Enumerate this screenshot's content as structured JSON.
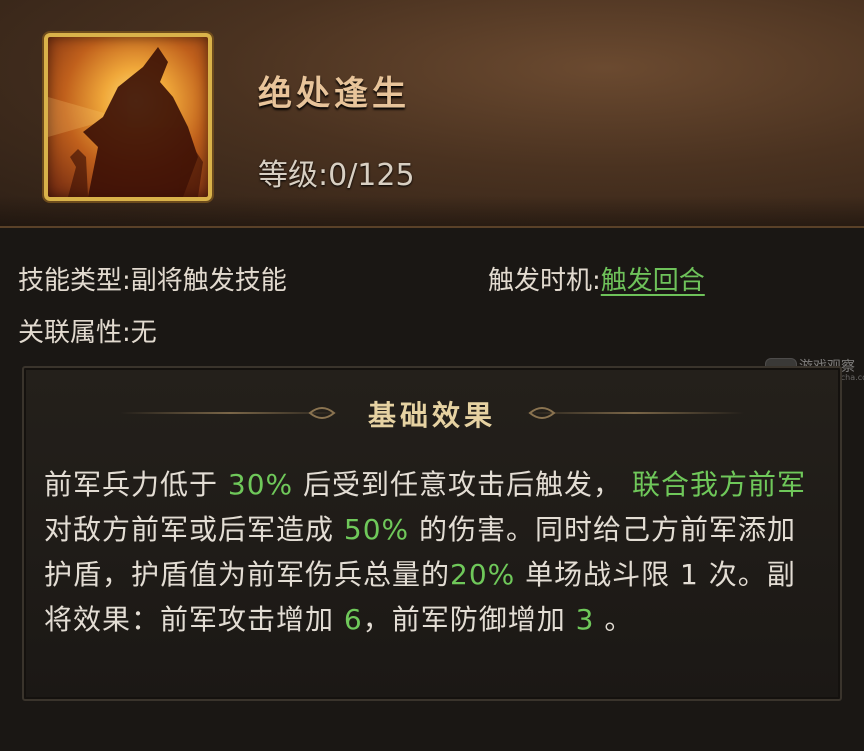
{
  "skill": {
    "name": "绝处逢生",
    "level_label": "等级:",
    "level_value": "0/125"
  },
  "info": {
    "type_label": "技能类型:",
    "type_value": "副将触发技能",
    "trigger_label": "触发时机:",
    "trigger_value": "触发回合",
    "attribute_label": "关联属性:",
    "attribute_value": "无"
  },
  "effect": {
    "title": "基础效果",
    "segments": [
      "前军兵力低于 ",
      "30%",
      " 后受到任意攻击后触发， ",
      "联合我方前军",
      " 对敌方前军或后军造成 ",
      "50%",
      " 的伤害。同时给己方前军添加护盾，护盾值为前军伤兵总量的",
      "20%",
      " 单场战斗限 1 次。副将效果：前军攻击增加 ",
      "6",
      "，前军防御增加 ",
      "3",
      " 。"
    ]
  },
  "watermark": {
    "text": "游戏观察",
    "sub": "youxiguancha.com"
  },
  "colors": {
    "highlight_green": "#6fc85a",
    "gold_border": "#d9b24a",
    "skill_name": "#e8c49a"
  }
}
